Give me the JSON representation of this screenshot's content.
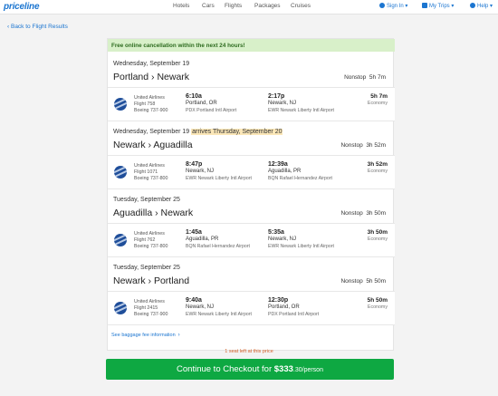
{
  "header": {
    "logo": "priceline",
    "nav": [
      "Hotels",
      "Cars",
      "Flights",
      "Packages",
      "Cruises"
    ],
    "sign_in": "Sign In",
    "my_trips": "My Trips",
    "help": "Help"
  },
  "back_link": "Back to Flight Results",
  "banner": "Free online cancellation within the next 24 hours!",
  "legs": [
    {
      "date": "Wednesday, September 19",
      "arrives_note": "",
      "from": "Portland",
      "to": "Newark",
      "stops": "Nonstop",
      "duration": "5h 7m",
      "segment": {
        "airline": "United Airlines",
        "flight": "Flight 758",
        "aircraft": "Boeing 737-900",
        "depart_time": "6:10a",
        "depart_city": "Portland, OR",
        "depart_airport": "PDX Portland Intl Airport",
        "arrive_time": "2:17p",
        "arrive_city": "Newark, NJ",
        "arrive_airport": "EWR Newark Liberty Intl Airport",
        "duration": "5h 7m",
        "cabin": "Economy"
      }
    },
    {
      "date": "Wednesday, September 19",
      "arrives_note": "arrives Thursday, September 20",
      "from": "Newark",
      "to": "Aguadilla",
      "stops": "Nonstop",
      "duration": "3h 52m",
      "segment": {
        "airline": "United Airlines",
        "flight": "Flight 1071",
        "aircraft": "Boeing 737-800",
        "depart_time": "8:47p",
        "depart_city": "Newark, NJ",
        "depart_airport": "EWR Newark Liberty Intl Airport",
        "arrive_time": "12:39a",
        "arrive_city": "Aguadilla, PR",
        "arrive_airport": "BQN Rafael Hernandez Airport",
        "duration": "3h 52m",
        "cabin": "Economy"
      }
    },
    {
      "date": "Tuesday, September 25",
      "arrives_note": "",
      "from": "Aguadilla",
      "to": "Newark",
      "stops": "Nonstop",
      "duration": "3h 50m",
      "segment": {
        "airline": "United Airlines",
        "flight": "Flight 762",
        "aircraft": "Boeing 737-800",
        "depart_time": "1:45a",
        "depart_city": "Aguadilla, PR",
        "depart_airport": "BQN Rafael Hernandez Airport",
        "arrive_time": "5:35a",
        "arrive_city": "Newark, NJ",
        "arrive_airport": "EWR Newark Liberty Intl Airport",
        "duration": "3h 50m",
        "cabin": "Economy"
      }
    },
    {
      "date": "Tuesday, September 25",
      "arrives_note": "",
      "from": "Newark",
      "to": "Portland",
      "stops": "Nonstop",
      "duration": "5h 50m",
      "segment": {
        "airline": "United Airlines",
        "flight": "Flight 2415",
        "aircraft": "Boeing 737-900",
        "depart_time": "9:40a",
        "depart_city": "Newark, NJ",
        "depart_airport": "EWR Newark Liberty Intl Airport",
        "arrive_time": "12:30p",
        "arrive_city": "Portland, OR",
        "arrive_airport": "PDX Portland Intl Airport",
        "duration": "5h 50m",
        "cabin": "Economy"
      }
    }
  ],
  "baggage_link": "See baggage fee information",
  "seats_left": "1 seat left at this price",
  "checkout": {
    "label": "Continue to Checkout for",
    "price_dollars": "$333",
    "price_cents": ".30",
    "per": "/person"
  },
  "colors": {
    "brand": "#1b75d0",
    "banner_bg": "#d8f0c9",
    "checkout_bg": "#0ea842",
    "seats_left": "#d4612a"
  }
}
